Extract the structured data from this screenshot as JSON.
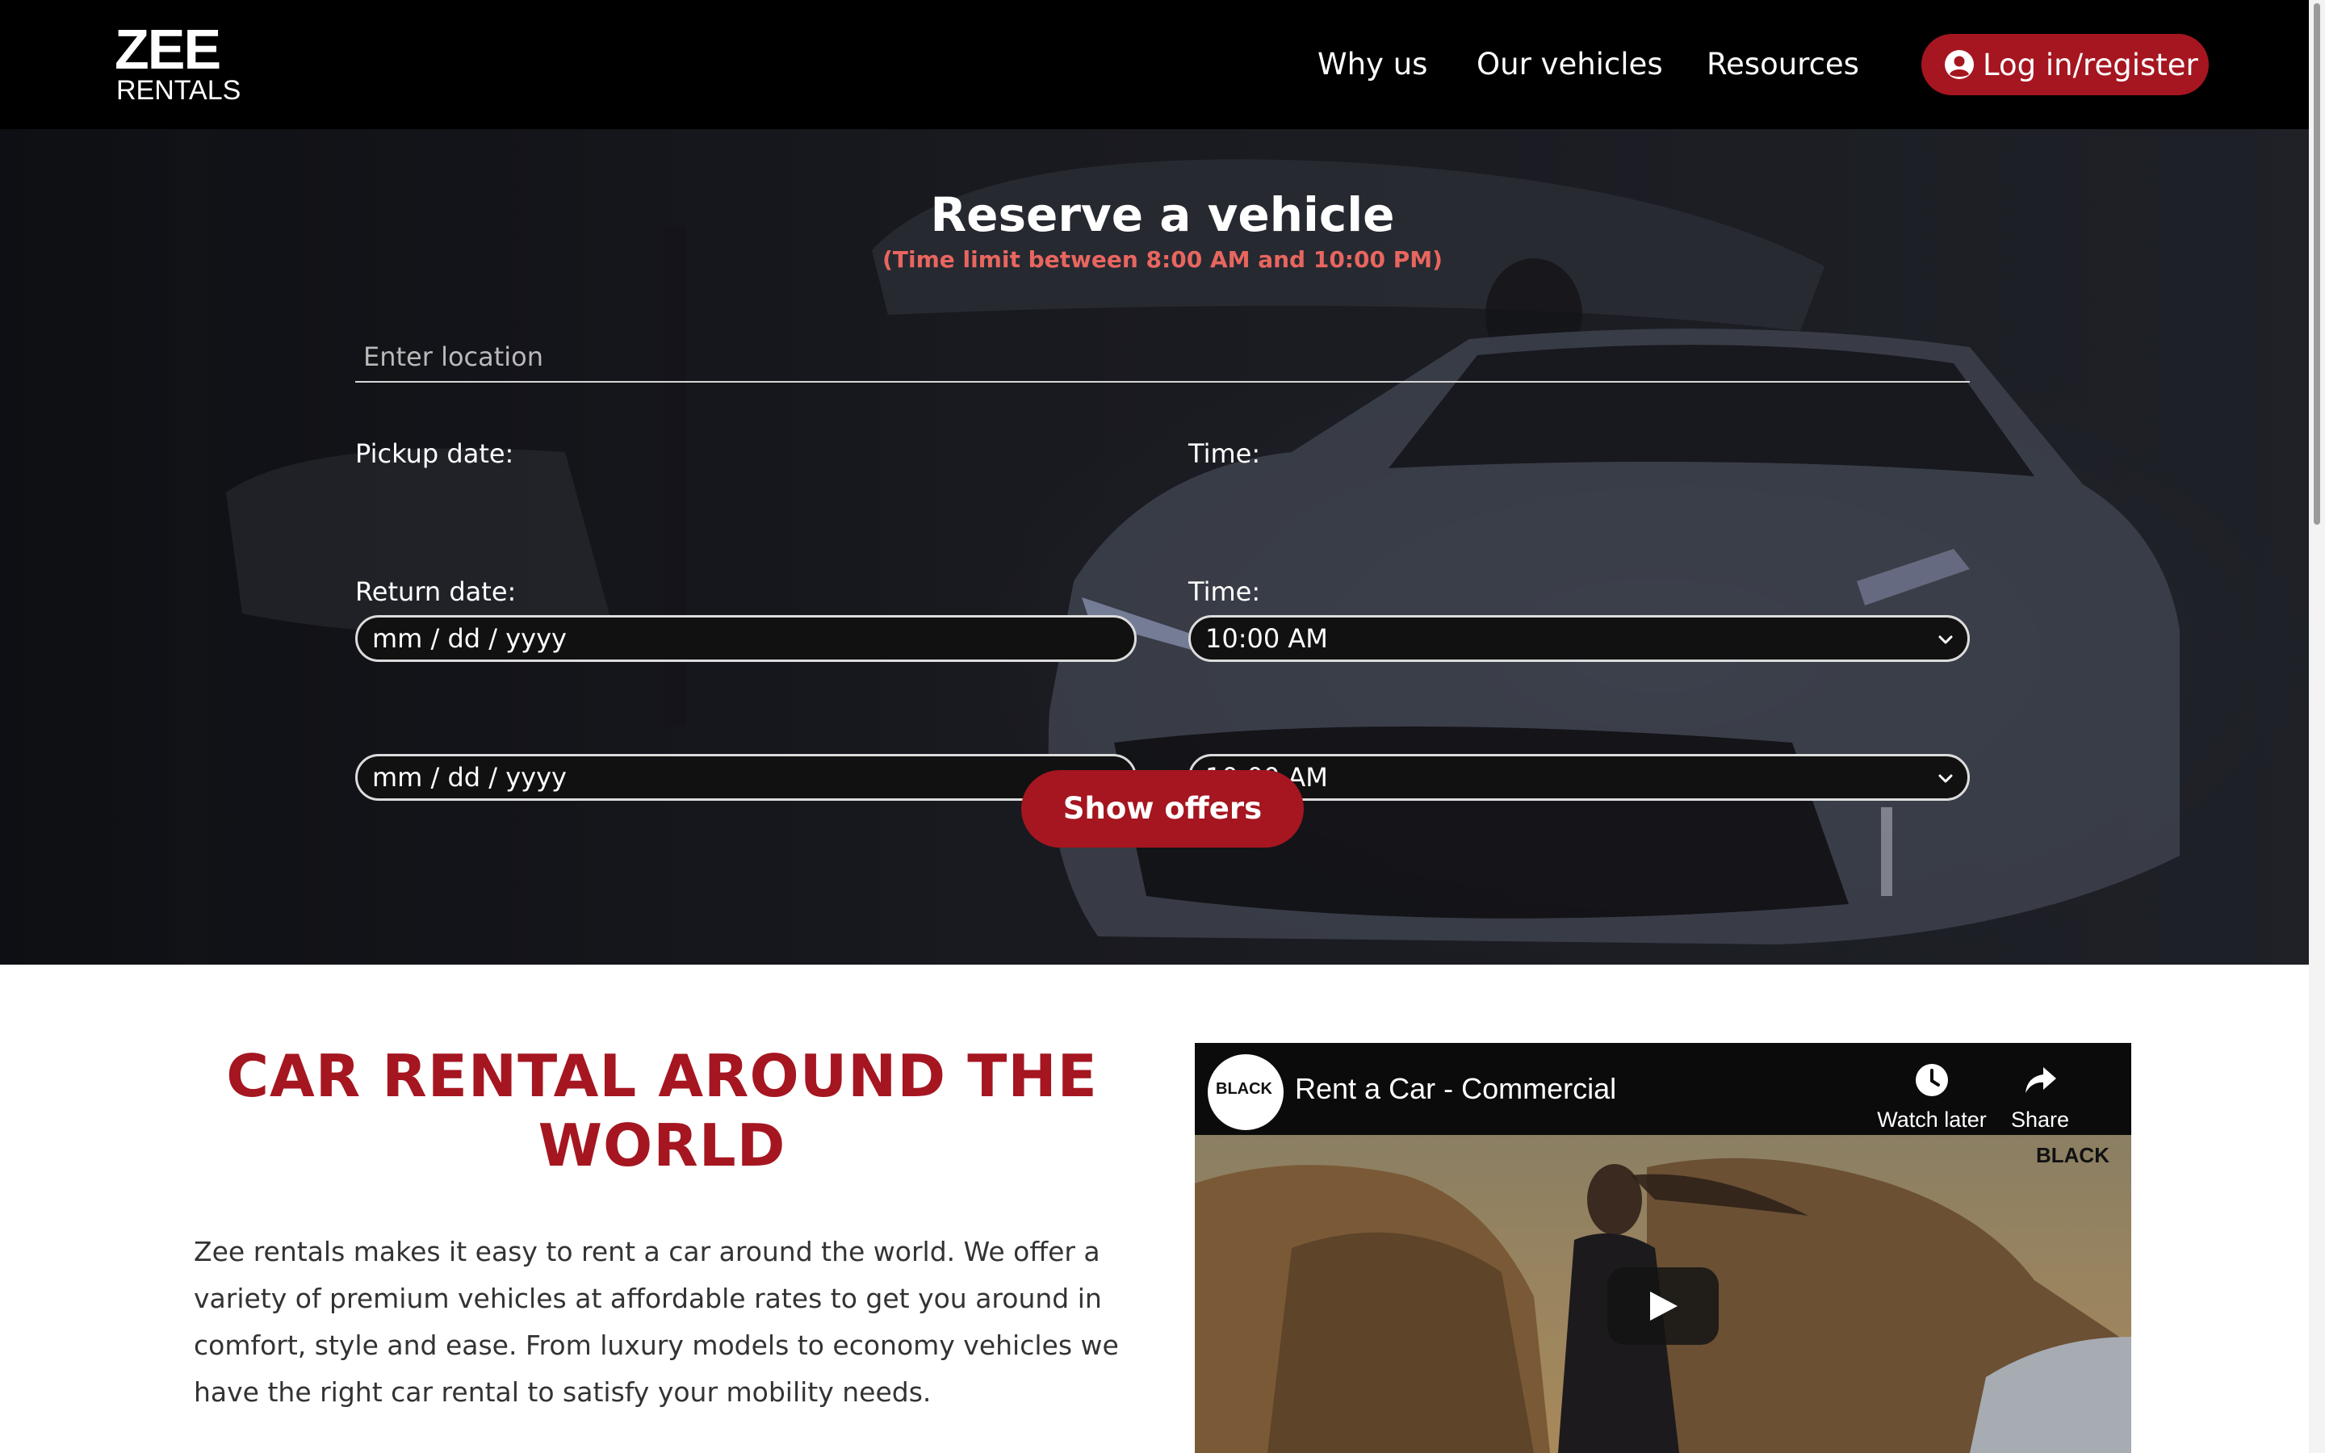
{
  "brand": {
    "logo_mark": "ZEE",
    "logo_sub": "RENTALS",
    "accent_color": "#a51620",
    "warning_color": "#e8665f"
  },
  "nav": {
    "links": [
      "Why us",
      "Our vehicles",
      "Resources"
    ],
    "login_label": "Log in/register",
    "login_icon": "user-circle-icon"
  },
  "hero": {
    "title": "Reserve a vehicle",
    "subtitle": "(Time limit between 8:00 AM and 10:00 PM)",
    "location_placeholder": "Enter location",
    "pickup_label": "Pickup date:",
    "pickup_value": "mm / dd / yyyy",
    "pickup_time_label": "Time:",
    "pickup_time_value": "10:00 AM",
    "return_label": "Return date:",
    "return_value": "mm / dd / yyyy",
    "return_time_label": "Time:",
    "return_time_value": "10:00 AM",
    "submit_label": "Show offers"
  },
  "intro": {
    "heading_line1": "CAR RENTAL AROUND THE",
    "heading_line2": "WORLD",
    "body": "Zee rentals makes it easy to rent a car around the world. We offer a variety of premium vehicles at affordable rates to get you around in comfort, style and ease. From luxury models to economy vehicles we have the right car rental to satisfy your mobility needs."
  },
  "video": {
    "channel_name": "BLACK",
    "title": "Rent a Car - Commercial",
    "watch_later_label": "Watch later",
    "share_label": "Share",
    "watermark": "BLACK"
  }
}
